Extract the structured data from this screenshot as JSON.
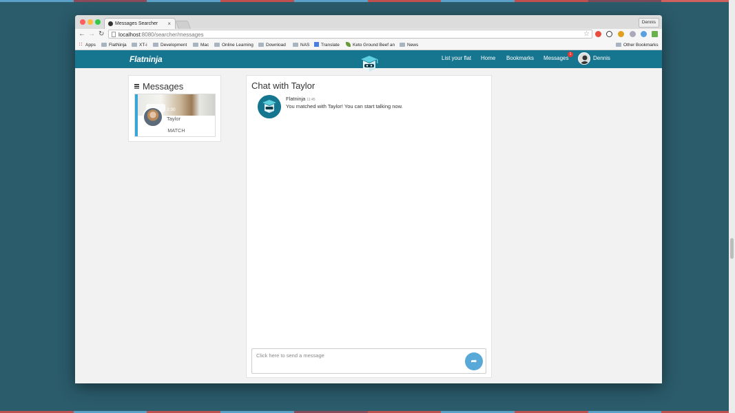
{
  "colors": {
    "desktop": "#2b5c6c",
    "app_bar": "#17768f",
    "card_accent": "#3aa6d6",
    "send_button": "#58a8d8",
    "badge": "#e53935"
  },
  "browser": {
    "tab_title": "Messages Searcher",
    "tab_close": "×",
    "profile": "Dennis",
    "url_host": "localhost",
    "url_path": ":8080/searcher/messages",
    "bookmarks": [
      "Apps",
      "FlatNinja",
      "XT-i",
      "Development",
      "Mac",
      "Online Learning",
      "Download",
      "NAS",
      "Translate",
      "Keto Ground Beef an",
      "News"
    ],
    "other_bookmarks": "Other Bookmarks"
  },
  "app": {
    "logo": "Flatninja",
    "nav": {
      "list_flat": "List your flat",
      "home": "Home",
      "bookmarks": "Bookmarks",
      "messages": "Messages",
      "messages_badge": "1",
      "user": "Dennis"
    }
  },
  "messages_panel": {
    "title": "Messages",
    "conversation": {
      "time": "2:30",
      "name": "Taylor",
      "status": "MATCH"
    }
  },
  "chat": {
    "title": "Chat with Taylor",
    "messages": [
      {
        "sender": "Flatninja",
        "time": "11:45",
        "text": "You matched with Taylor! You can start talking now."
      }
    ],
    "input_placeholder": "Click here to send a message"
  }
}
